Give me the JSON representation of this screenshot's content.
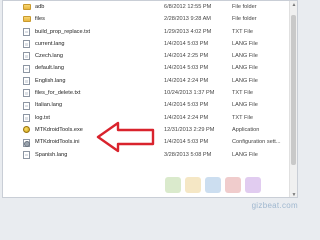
{
  "files": [
    {
      "name": "adb",
      "date": "6/8/2012 12:55 PM",
      "type": "File folder",
      "icon": "folder-icon"
    },
    {
      "name": "files",
      "date": "2/28/2013 9:28 AM",
      "type": "File folder",
      "icon": "folder-icon"
    },
    {
      "name": "build_prop_replace.txt",
      "date": "1/29/2013 4:02 PM",
      "type": "TXT File",
      "icon": "text-file-icon"
    },
    {
      "name": "current.lang",
      "date": "1/4/2014 5:03 PM",
      "type": "LANG File",
      "icon": "text-file-icon"
    },
    {
      "name": "Czech.lang",
      "date": "1/4/2014 2:25 PM",
      "type": "LANG File",
      "icon": "text-file-icon"
    },
    {
      "name": "default.lang",
      "date": "1/4/2014 5:03 PM",
      "type": "LANG File",
      "icon": "text-file-icon"
    },
    {
      "name": "English.lang",
      "date": "1/4/2014 2:24 PM",
      "type": "LANG File",
      "icon": "text-file-icon"
    },
    {
      "name": "files_for_delete.txt",
      "date": "10/24/2013 1:37 PM",
      "type": "TXT File",
      "icon": "text-file-icon"
    },
    {
      "name": "Italian.lang",
      "date": "1/4/2014 5:03 PM",
      "type": "LANG File",
      "icon": "text-file-icon"
    },
    {
      "name": "log.txt",
      "date": "1/4/2014 2:24 PM",
      "type": "TXT File",
      "icon": "text-file-icon"
    },
    {
      "name": "MTKdroidTools.exe",
      "date": "12/31/2013 2:29 PM",
      "type": "Application",
      "icon": "application-icon"
    },
    {
      "name": "MTKdroidTools.ini",
      "date": "1/4/2014 5:03 PM",
      "type": "Configuration sett...",
      "icon": "config-file-icon"
    },
    {
      "name": "Spanish.lang",
      "date": "3/28/2013 5:08 PM",
      "type": "LANG File",
      "icon": "text-file-icon"
    }
  ],
  "annotation": {
    "color": "#d9232d",
    "target": "MTKdroidTools.exe"
  },
  "watermark": "gizbeat.com"
}
